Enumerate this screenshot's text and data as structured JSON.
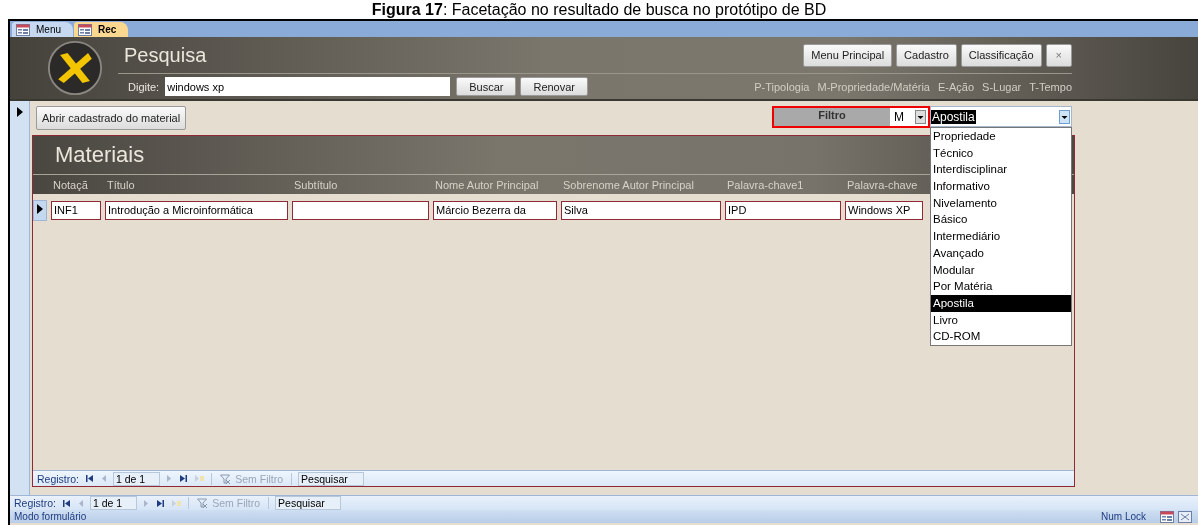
{
  "caption": "**Figura 17**: Facetação no resultado de busca no protótipo de BD",
  "tabs": [
    {
      "label": "Menu",
      "selected": false
    },
    {
      "label": "Rec",
      "selected": true
    }
  ],
  "header": {
    "title": "Pesquisa",
    "buttons": [
      "Menu Principal",
      "Cadastro",
      "Classificação",
      "×"
    ],
    "search_label": "Digite:",
    "search_value": "windows xp",
    "search_buttons": [
      "Buscar",
      "Renovar"
    ],
    "facets": [
      "P-Tipologia",
      "M-Propriedade/Matéria",
      "E-Ação",
      "S-Lugar",
      "T-Tempo"
    ]
  },
  "open_button": "Abrir cadastrado do material",
  "filter": {
    "label": "Filtro",
    "facet_value": "M",
    "value": "Apostila",
    "options": [
      {
        "label": "Propriedade",
        "selected": false
      },
      {
        "label": "Técnico",
        "selected": false
      },
      {
        "label": "Interdisciplinar",
        "selected": false
      },
      {
        "label": "Informativo",
        "selected": false
      },
      {
        "label": "Nivelamento",
        "selected": false
      },
      {
        "label": "Básico",
        "selected": false
      },
      {
        "label": "Intermediário",
        "selected": false
      },
      {
        "label": "Avançado",
        "selected": false
      },
      {
        "label": "Modular",
        "selected": false
      },
      {
        "label": "Por Matéria",
        "selected": false
      },
      {
        "label": "Apostila",
        "selected": true
      },
      {
        "label": "Livro",
        "selected": false
      },
      {
        "label": "CD-ROM",
        "selected": false
      }
    ]
  },
  "subform": {
    "title": "Materiais",
    "columns": [
      "Notaçã",
      "Título",
      "Subtítulo",
      "Nome Autor Principal",
      "Sobrenome Autor Principal",
      "Palavra-chave1",
      "Palavra-chave"
    ],
    "rows": [
      {
        "selected": true,
        "cells": [
          {
            "value": "INF1"
          },
          {
            "value": "Introdução a Microinformática"
          },
          {},
          {
            "value": "Márcio Bezerra da"
          },
          {
            "value": "Silva"
          },
          {
            "value": "IPD"
          },
          {
            "value": "Windows XP"
          }
        ]
      }
    ],
    "nav": {
      "label": "Registro:",
      "position": "1 de 1",
      "filter": {
        "label": "Sem Filtro",
        "disabled": true
      },
      "search": {
        "placeholder": "Pesquisar"
      }
    }
  },
  "nav": {
    "label": "Registro:",
    "position": "1 de 1",
    "filter": {
      "label": "Sem Filtro",
      "disabled": true
    },
    "search": {
      "placeholder": "Pesquisar"
    }
  },
  "status_bar": {
    "mode": "Modo formulário",
    "indicator": "Num Lock"
  }
}
